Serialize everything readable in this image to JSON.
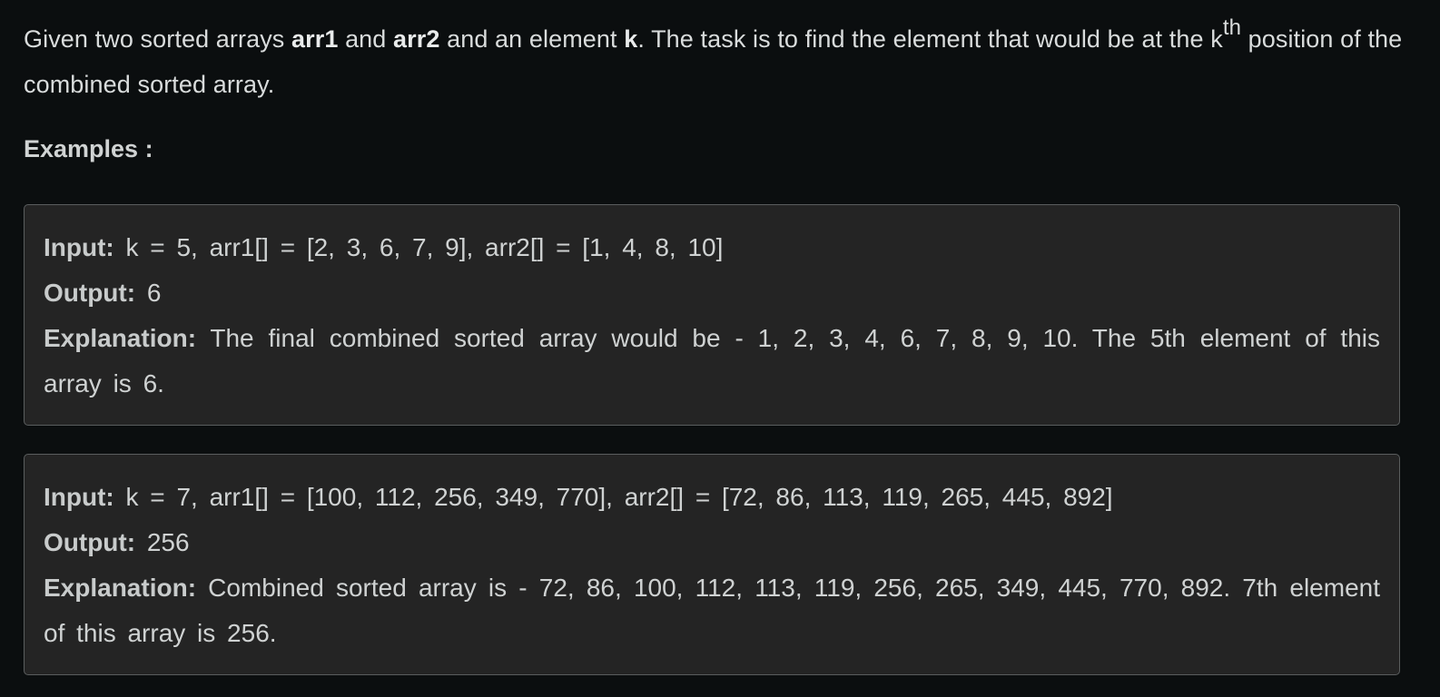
{
  "statement": {
    "part1": "Given two sorted arrays ",
    "arr1": "arr1",
    "part2": " and ",
    "arr2": "arr2",
    "part3": " and an element ",
    "k": "k",
    "part4": ". The task is to find the element that would be at the k",
    "sup": "th",
    "part5": " position of the combined sorted array."
  },
  "examples_heading": "Examples :",
  "examples": [
    {
      "input_label": "Input:",
      "input_value": " k = 5, arr1[] = [2, 3, 6, 7, 9], arr2[] = [1, 4, 8, 10]",
      "output_label": "Output:",
      "output_value": " 6",
      "explanation_label": "Explanation:",
      "explanation_value": " The final combined sorted array would be - 1, 2, 3, 4, 6, 7, 8, 9, 10. The 5th element of this array is 6."
    },
    {
      "input_label": "Input:",
      "input_value": " k = 7, arr1[] = [100, 112, 256, 349, 770], arr2[] = [72, 86, 113, 119, 265, 445, 892]",
      "output_label": "Output:",
      "output_value": " 256",
      "explanation_label": "Explanation:",
      "explanation_value": " Combined sorted array is - 72, 86, 100, 112, 113, 119, 256, 265, 349, 445, 770, 892. 7th element of this array is 256."
    }
  ]
}
